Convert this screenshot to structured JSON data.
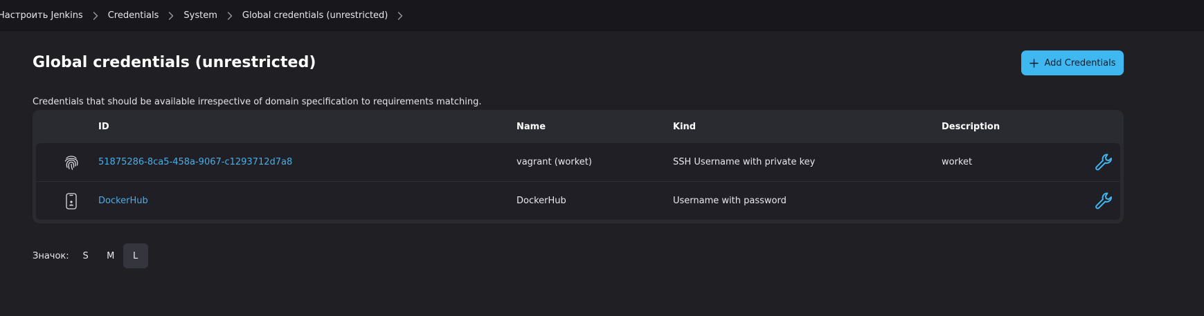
{
  "breadcrumb": [
    {
      "label": "Настроить Jenkins"
    },
    {
      "label": "Credentials"
    },
    {
      "label": "System"
    },
    {
      "label": "Global credentials (unrestricted)"
    }
  ],
  "page": {
    "title": "Global credentials (unrestricted)",
    "add_button_label": "Add Credentials",
    "description": "Credentials that should be available irrespective of domain specification to requirements matching."
  },
  "table": {
    "columns": {
      "id": "ID",
      "name": "Name",
      "kind": "Kind",
      "description": "Description"
    },
    "rows": [
      {
        "icon": "fingerprint-icon",
        "id": "51875286-8ca5-458a-9067-c1293712d7a8",
        "name": "vagrant (worket)",
        "kind": "SSH Username with private key",
        "description": "worket",
        "action_icon": "wrench-icon"
      },
      {
        "icon": "mobile-device-icon",
        "id": "DockerHub",
        "name": "DockerHub",
        "kind": "Username with password",
        "description": "",
        "action_icon": "wrench-icon"
      }
    ]
  },
  "icon_size": {
    "label": "Значок:",
    "options": [
      "S",
      "M",
      "L"
    ],
    "selected": "L"
  },
  "colors": {
    "background": "#1f1f24",
    "breadcrumb_bar": "#18181c",
    "accent": "#3fb7f0",
    "link": "#4aaee6"
  }
}
